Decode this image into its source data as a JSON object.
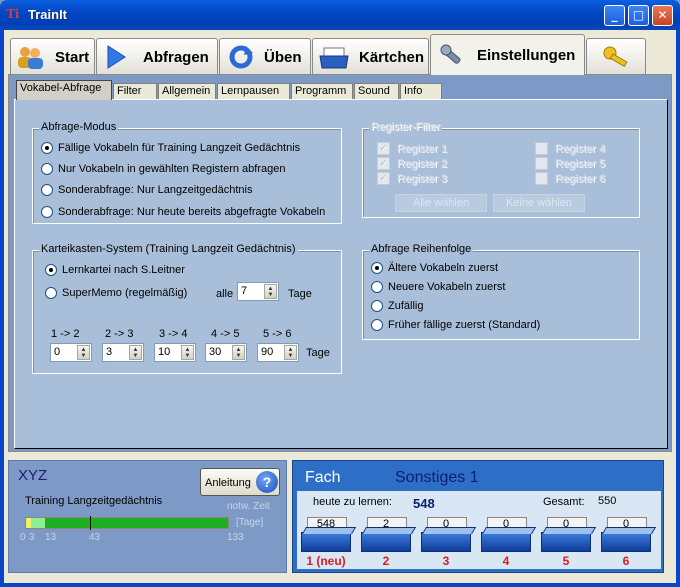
{
  "window": {
    "title": "TrainIt",
    "icon_glyph": "Ti",
    "minimize_glyph": "_",
    "maximize_glyph": "□",
    "close_glyph": "✕"
  },
  "main_tabs": [
    {
      "label": "Start",
      "icon": "users-icon"
    },
    {
      "label": "Abfragen",
      "icon": "play-arrow-icon"
    },
    {
      "label": "Üben",
      "icon": "refresh-icon"
    },
    {
      "label": "Kärtchen",
      "icon": "card-box-icon"
    },
    {
      "label": "Einstellungen",
      "icon": "wrench-icon",
      "active": true
    },
    {
      "label": "",
      "icon": "key-icon"
    }
  ],
  "sub_tabs": [
    "Vokabel-Abfrage",
    "Filter",
    "Allgemein",
    "Lernpausen",
    "Programm",
    "Sound",
    "Info"
  ],
  "abfrage_modus": {
    "title": "Abfrage-Modus",
    "options": [
      "Fällige Vokabeln für Training Langzeit Gedächtnis",
      "Nur Vokabeln in gewählten Registern abfragen",
      "Sonderabfrage: Nur Langzeitgedächtnis",
      "Sonderabfrage: Nur heute bereits abgefragte Vokabeln"
    ],
    "selected": 0
  },
  "register_filter": {
    "title": "Register-Filter",
    "registers": [
      {
        "label": "Register 1",
        "checked": true
      },
      {
        "label": "Register 2",
        "checked": true
      },
      {
        "label": "Register 3",
        "checked": true
      },
      {
        "label": "Register 4",
        "checked": false
      },
      {
        "label": "Register 5",
        "checked": false
      },
      {
        "label": "Register 6",
        "checked": false
      }
    ],
    "select_all": "Alle wählen",
    "select_none": "Keine wählen"
  },
  "karteikasten": {
    "title": "Karteikasten-System (Training Langzeit Gedächtnis)",
    "option_leitner": "Lernkartei nach S.Leitner",
    "option_supermemo": "SuperMemo (regelmäßig)",
    "alle_label": "alle",
    "alle_value": "7",
    "tage_label": "Tage",
    "steps": [
      {
        "label": "1 -> 2",
        "value": "0"
      },
      {
        "label": "2 -> 3",
        "value": "3"
      },
      {
        "label": "3 -> 4",
        "value": "10"
      },
      {
        "label": "4 -> 5",
        "value": "30"
      },
      {
        "label": "5 -> 6",
        "value": "90"
      }
    ],
    "steps_unit": "Tage"
  },
  "reihenfolge": {
    "title": "Abfrage Reihenfolge",
    "options": [
      "Ältere Vokabeln zuerst",
      "Neuere Vokabeln zuerst",
      "Zufällig",
      "Früher fällige zuerst (Standard)"
    ],
    "selected": 0
  },
  "xyz": {
    "name": "XYZ",
    "subtitle": "Training Langzeitgedächtnis",
    "help_button": "Anleitung",
    "help_icon": "?",
    "notw_label": "notw. Zeit",
    "tage_label": "[Tage]",
    "ticks": [
      "0",
      "3",
      "13",
      "43",
      "133"
    ],
    "progress_color": "#1fae1f"
  },
  "fach": {
    "label": "Fach",
    "name": "Sonstiges 1",
    "heute_label": "heute zu lernen:",
    "heute_value": "548",
    "gesamt_label": "Gesamt:",
    "gesamt_value": "550",
    "boxes": [
      {
        "count": "548",
        "label": "1 (neu)"
      },
      {
        "count": "2",
        "label": "2"
      },
      {
        "count": "0",
        "label": "3"
      },
      {
        "count": "0",
        "label": "4"
      },
      {
        "count": "0",
        "label": "5"
      },
      {
        "count": "0",
        "label": "6"
      }
    ]
  },
  "spin_arrows": {
    "up": "▲",
    "down": "▼"
  }
}
